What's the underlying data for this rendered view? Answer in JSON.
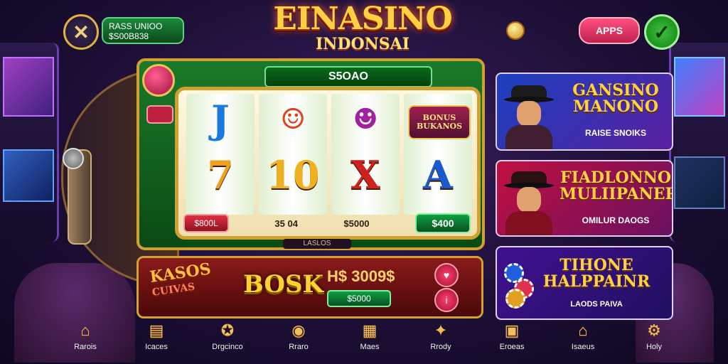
{
  "header": {
    "close_label": "✕",
    "confirm_label": "✓",
    "balance_line1": "RASS UNIOO",
    "balance_line2": "$S00B838",
    "apps_label": "APPS",
    "logo_line1": "EINASINO",
    "logo_line2": "INDONSAI"
  },
  "slot": {
    "top_display": "S5OAO",
    "under_label": "LASLOS",
    "reels": [
      {
        "top": "J",
        "mid": "7",
        "top_color": "#1a7ae0",
        "mid_color": "#f0a020"
      },
      {
        "top": "clown-icon",
        "mid": "10",
        "top_color": "#e04020",
        "mid_color": "#f0b020"
      },
      {
        "top": "jester-icon",
        "mid": "X",
        "top_color": "#a020a0",
        "mid_color": "#d02020"
      },
      {
        "top": "BONUS BUKANOS",
        "mid": "A",
        "top_color": "#ffe080",
        "mid_color": "#1a5ad0"
      }
    ],
    "bet_left": "$800L",
    "num_a": "35 04",
    "num_b": "$5000",
    "win_value": "$400"
  },
  "bonus": {
    "logo_line1": "KASOS",
    "logo_line2": "CUIVAS",
    "center": "BOSK",
    "amount": "H$ 3009$",
    "green_value": "$5000",
    "heart_icon": "♥",
    "info_icon": "i"
  },
  "promos": [
    {
      "title": "GANSINO MANONO",
      "subtitle": "RAISE SNOIKS"
    },
    {
      "title": "FIADLONNO MULIIPANER",
      "subtitle": "OMILUR DAOGS"
    },
    {
      "title": "TIHONE HALPPAINR",
      "subtitle": "LAODS PAIVA"
    }
  ],
  "nav": [
    {
      "label": "Rarois",
      "icon": "home-icon"
    },
    {
      "label": "Icaces",
      "icon": "cards-icon"
    },
    {
      "label": "Drgcinco",
      "icon": "tag-icon"
    },
    {
      "label": "Rraro",
      "icon": "badge-icon"
    },
    {
      "label": "Maes",
      "icon": "building-icon"
    },
    {
      "label": "Rrody",
      "icon": "puzzle-icon"
    },
    {
      "label": "Eroeas",
      "icon": "slots-icon"
    },
    {
      "label": "Isaeus",
      "icon": "house-icon"
    },
    {
      "label": "Holy",
      "icon": "gear-icon"
    }
  ],
  "colors": {
    "accent_gold": "#d0a030",
    "felt_green": "#1a7a2a",
    "bonus_red": "#8a1a1a"
  }
}
